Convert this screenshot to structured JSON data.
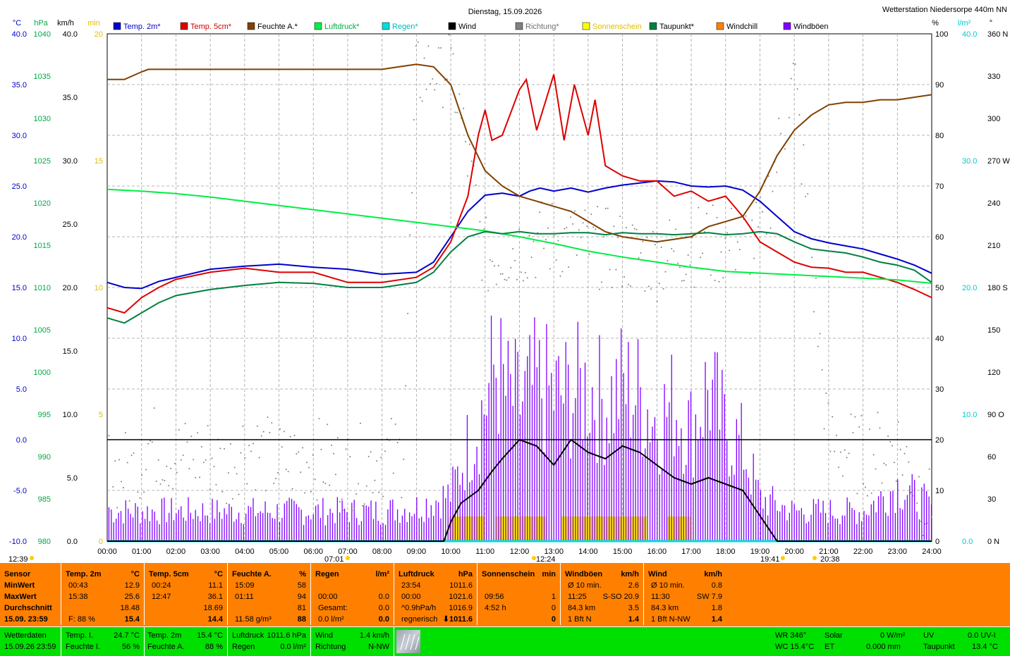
{
  "title": "Dienstag, 15.09.2026",
  "station": "Wetterstation Niedersorpe 440m NN",
  "axis_units": {
    "temp": "°C",
    "hpa": "hPa",
    "kmh": "km/h",
    "min": "min",
    "pct": "%",
    "lm2": "l/m²",
    "deg": "°"
  },
  "axis_ticks": {
    "temp": [
      "40.0",
      "35.0",
      "30.0",
      "25.0",
      "20.0",
      "15.0",
      "10.0",
      "5.0",
      "0.0",
      "-5.0",
      "-10.0"
    ],
    "hpa": [
      "1040",
      "1035",
      "1030",
      "1025",
      "1020",
      "1015",
      "1010",
      "1005",
      "1000",
      "995",
      "990",
      "985",
      "980"
    ],
    "kmh": [
      "40.0",
      "35.0",
      "30.0",
      "25.0",
      "20.0",
      "15.0",
      "10.0",
      "5.0",
      "0.0"
    ],
    "min": [
      "20",
      "15",
      "10",
      "5",
      "0"
    ],
    "pct": [
      "100",
      "90",
      "80",
      "70",
      "60",
      "50",
      "40",
      "30",
      "20",
      "10",
      "0"
    ],
    "lm2": [
      "40.0",
      "30.0",
      "20.0",
      "10.0",
      "0.0"
    ],
    "deg": [
      "360 N",
      "330",
      "300",
      "270 W",
      "240",
      "210",
      "180 S",
      "150",
      "120",
      "90 O",
      "60",
      "30",
      "0 N"
    ],
    "time": [
      "00:00",
      "01:00",
      "02:00",
      "03:00",
      "04:00",
      "05:00",
      "06:00",
      "07:00",
      "08:00",
      "09:00",
      "10:00",
      "11:00",
      "12:00",
      "13:00",
      "14:00",
      "15:00",
      "16:00",
      "17:00",
      "18:00",
      "19:00",
      "20:00",
      "21:00",
      "22:00",
      "23:00",
      "24:00"
    ]
  },
  "sun_marks": {
    "left": "12:39",
    "sunrise": "07:01",
    "noon": "12:24",
    "set1": "19:41",
    "set2": "20:38"
  },
  "chart_data": {
    "type": "line",
    "title": "Dienstag, 15.09.2026",
    "x_unit": "hours",
    "legend": [
      "Temp. 2m*",
      "Temp. 5cm*",
      "Feuchte A.*",
      "Luftdruck*",
      "Regen*",
      "Wind",
      "Richtung*",
      "Sonnenschein",
      "Taupunkt*",
      "Windchill",
      "Windböen"
    ],
    "colors": {
      "Temp. 2m*": "#0000cc",
      "Temp. 5cm*": "#dd0000",
      "Feuchte A.*": "#804000",
      "Luftdruck*": "#00ee44",
      "Regen*": "#00dddd",
      "Wind": "#000000",
      "Richtung*": "#808080",
      "Sonnenschein": "#ffff00",
      "Taupunkt*": "#008040",
      "Windchill": "#ff8000",
      "Windböen": "#8000ff"
    },
    "series": [
      {
        "name": "Temp. 2m*",
        "axis": "temp",
        "x": [
          0,
          0.5,
          1,
          1.5,
          2,
          3,
          4,
          5,
          6,
          7,
          8,
          9,
          9.5,
          10,
          10.5,
          11,
          11.5,
          12,
          12.3,
          12.6,
          13,
          13.5,
          14,
          14.5,
          15,
          15.5,
          16,
          16.5,
          17,
          17.5,
          18,
          18.5,
          19,
          19.5,
          20,
          20.5,
          21,
          21.5,
          22,
          22.5,
          23,
          23.5,
          24
        ],
        "y": [
          15.5,
          15,
          14.9,
          15.6,
          16.0,
          16.8,
          17.1,
          17.3,
          17.0,
          16.8,
          16.3,
          16.5,
          17.5,
          20.0,
          22.5,
          24.1,
          24.3,
          24.0,
          24.5,
          24.8,
          24.5,
          24.8,
          24.4,
          24.8,
          25.1,
          25.3,
          25.5,
          25.4,
          25.0,
          24.9,
          25.0,
          24.6,
          23.5,
          22.0,
          20.5,
          19.8,
          19.4,
          19.1,
          18.8,
          18.3,
          17.8,
          17.2,
          16.4
        ]
      },
      {
        "name": "Temp. 5cm*",
        "axis": "temp",
        "x": [
          0,
          0.5,
          1,
          1.5,
          2,
          3,
          4,
          5,
          6,
          7,
          8,
          9,
          9.5,
          10,
          10.5,
          10.8,
          11,
          11.2,
          11.5,
          12,
          12.2,
          12.5,
          13,
          13.3,
          13.6,
          14,
          14.2,
          14.5,
          15,
          15.5,
          16,
          16.5,
          17,
          17.5,
          18,
          18.5,
          19,
          19.5,
          20,
          20.5,
          21,
          21.5,
          22,
          22.5,
          23,
          23.5,
          24
        ],
        "y": [
          13,
          12.5,
          14,
          15,
          15.8,
          16.5,
          16.9,
          16.5,
          16.5,
          15.5,
          15.5,
          16.0,
          17.0,
          19.5,
          24.0,
          30,
          32.5,
          29.5,
          30,
          34.5,
          35.5,
          30.5,
          36,
          29.5,
          35,
          30,
          33.5,
          27,
          26,
          25.5,
          25.5,
          24,
          24.5,
          23.5,
          24,
          22,
          19.5,
          18.5,
          17.5,
          17,
          16.9,
          16.5,
          16.5,
          16.0,
          15.5,
          14.8,
          14.0
        ]
      },
      {
        "name": "Feuchte A.*",
        "axis": "pct",
        "x": [
          0,
          0.5,
          1,
          1.2,
          1.5,
          2,
          3,
          4,
          5,
          6,
          7,
          8,
          8.5,
          9,
          9.5,
          10,
          10.5,
          11,
          11.5,
          12,
          12.5,
          13,
          13.5,
          14,
          14.5,
          15,
          15.5,
          16,
          16.5,
          17,
          17.5,
          18,
          18.5,
          19,
          19.5,
          20,
          20.5,
          21,
          21.5,
          22,
          22.5,
          23,
          23.5,
          24
        ],
        "y": [
          91,
          91,
          92.5,
          93,
          93,
          93,
          93,
          93,
          93,
          93,
          93,
          93,
          93.5,
          94,
          93.5,
          90,
          80,
          73,
          70,
          68,
          67,
          66,
          65,
          63,
          61,
          60,
          59.5,
          59,
          59.5,
          60,
          62,
          63,
          64,
          69,
          76,
          81,
          84,
          86,
          86.5,
          86.5,
          87,
          87,
          87.5,
          88
        ]
      },
      {
        "name": "Luftdruck*",
        "axis": "hpa",
        "x": [
          0,
          1,
          2,
          3,
          4,
          5,
          6,
          7,
          8,
          9,
          10,
          11,
          12,
          13,
          14,
          15,
          16,
          17,
          18,
          19,
          20,
          21,
          22,
          23,
          24
        ],
        "y": [
          1021.6,
          1021.4,
          1021.1,
          1020.7,
          1020.2,
          1019.7,
          1019.2,
          1018.7,
          1018.2,
          1017.7,
          1017.2,
          1016.7,
          1016.0,
          1015.2,
          1014.3,
          1013.6,
          1013.0,
          1012.4,
          1011.9,
          1011.7,
          1011.5,
          1011.3,
          1011.1,
          1010.9,
          1010.5
        ]
      },
      {
        "name": "Taupunkt*",
        "axis": "temp",
        "x": [
          0,
          0.5,
          1,
          1.5,
          2,
          3,
          4,
          5,
          6,
          7,
          8,
          9,
          9.5,
          10,
          10.5,
          11,
          11.5,
          12,
          12.5,
          13,
          13.5,
          14,
          14.5,
          15,
          15.5,
          16,
          16.5,
          17,
          17.5,
          18,
          18.5,
          19,
          19.5,
          20,
          20.5,
          21,
          21.5,
          22,
          22.5,
          23,
          23.5,
          24
        ],
        "y": [
          12,
          11.5,
          12.5,
          13.5,
          14.2,
          14.8,
          15.2,
          15.5,
          15.4,
          15.0,
          15.0,
          15.5,
          16.5,
          18.5,
          20.0,
          20.5,
          20.3,
          20.5,
          20.3,
          20.3,
          20.4,
          20.4,
          20.2,
          20.4,
          20.3,
          20.3,
          20.2,
          20.3,
          20.4,
          20.2,
          20.3,
          20.5,
          20.3,
          19.5,
          18.8,
          18.6,
          18.4,
          18.0,
          17.5,
          17.2,
          16.7,
          15.5
        ]
      },
      {
        "name": "Regen*",
        "axis": "lm2",
        "x": [
          0,
          24
        ],
        "y": [
          0,
          0
        ]
      },
      {
        "name": "Wind",
        "axis": "kmh",
        "x": [
          0,
          9.8,
          10,
          10.3,
          10.8,
          11.2,
          11.5,
          12,
          12.5,
          13,
          13.5,
          14,
          14.5,
          15,
          15.5,
          16,
          16.5,
          17,
          17.5,
          18,
          18.5,
          19,
          19.5,
          24
        ],
        "y": [
          0,
          0,
          1.5,
          3.0,
          4.0,
          5.5,
          6.5,
          8.0,
          7.5,
          6.0,
          8.0,
          7.0,
          6.5,
          7.5,
          7.0,
          6.0,
          5.0,
          4.5,
          5.0,
          4.5,
          4.0,
          2.0,
          0,
          0
        ]
      },
      {
        "name": "Windböen",
        "axis": "kmh",
        "note": "gust peaks",
        "x": [
          0.1,
          0.8,
          1.2,
          2,
          3,
          4,
          5,
          6,
          7,
          8,
          9,
          10,
          10.5,
          11,
          11.3,
          11.6,
          12,
          12.5,
          13,
          13.5,
          14,
          14.5,
          15,
          15.5,
          16,
          16.5,
          17,
          17.5,
          18,
          18.5,
          19,
          20,
          21,
          22,
          23,
          24
        ],
        "y": [
          3.5,
          3.5,
          3.5,
          3.5,
          3.5,
          3.5,
          3.5,
          3.5,
          3.5,
          3.5,
          4.0,
          5.5,
          11.0,
          16.0,
          20.9,
          17.0,
          16.0,
          18.0,
          17.0,
          17.0,
          18.0,
          16.0,
          18.0,
          17.0,
          14.0,
          16.0,
          13.0,
          18.0,
          13.0,
          11.0,
          5.0,
          3.5,
          3.5,
          3.5,
          6.5,
          4.0
        ]
      },
      {
        "name": "Sonnenschein",
        "axis": "min",
        "x": [
          9.95,
          10.5,
          11,
          11.3,
          12,
          12.8,
          13.2,
          13.8,
          14.5,
          15,
          15.7,
          16.3,
          17
        ],
        "y": [
          1,
          1,
          0,
          1,
          1,
          0,
          1,
          1,
          1,
          1,
          0,
          1,
          1
        ]
      },
      {
        "name": "Richtung*",
        "axis": "deg",
        "x": [
          0,
          0.9,
          1.2,
          2,
          2.5,
          3,
          3.5,
          4,
          5,
          6,
          7,
          8,
          8.6,
          9,
          10,
          11,
          12,
          13,
          14,
          15,
          16,
          17,
          18,
          19,
          20,
          21,
          22,
          23,
          24
        ],
        "y": [
          50,
          50,
          70,
          60,
          60,
          60,
          50,
          70,
          55,
          60,
          50,
          60,
          60,
          330,
          340,
          200,
          210,
          215,
          210,
          205,
          200,
          210,
          210,
          215,
          330,
          70,
          60,
          70,
          20
        ]
      }
    ],
    "ylim": {
      "temp": [
        -10,
        40
      ],
      "hpa": [
        980,
        1040
      ],
      "kmh": [
        0,
        40
      ],
      "min": [
        0,
        20
      ],
      "pct": [
        0,
        100
      ],
      "lm2": [
        0,
        40
      ],
      "deg": [
        0,
        360
      ]
    },
    "xlim": [
      0,
      24
    ],
    "grid": true
  },
  "stats": {
    "sensor": {
      "title": "Sensor",
      "rows": [
        "MinWert",
        "MaxWert",
        "Durchschnitt",
        "15.09. 23:59"
      ]
    },
    "temp2m": {
      "title": "Temp. 2m",
      "unit": "°C",
      "rows": [
        [
          "00:43",
          "12.9"
        ],
        [
          "15:38",
          "25.6"
        ],
        [
          "",
          "18.48"
        ],
        [
          "F: 88 %",
          "15.4"
        ]
      ]
    },
    "temp5cm": {
      "title": "Temp. 5cm",
      "unit": "°C",
      "rows": [
        [
          "00:24",
          "11.1"
        ],
        [
          "12:47",
          "36.1"
        ],
        [
          "",
          "18.69"
        ],
        [
          "",
          "14.4"
        ]
      ]
    },
    "feuchte": {
      "title": "Feuchte A.",
      "unit": "%",
      "rows": [
        [
          "15:09",
          "58"
        ],
        [
          "01:11",
          "94"
        ],
        [
          "",
          "81"
        ],
        [
          "11.58 g/m³",
          "88"
        ]
      ]
    },
    "regen": {
      "title": "Regen",
      "unit": "l/m²",
      "rows": [
        [
          "",
          ""
        ],
        [
          "00:00",
          "0.0"
        ],
        [
          "Gesamt:",
          "0.0"
        ],
        [
          "0.0 l/m²",
          "0.0"
        ]
      ]
    },
    "luftdruck": {
      "title": "Luftdruck",
      "unit": "hPa",
      "rows": [
        [
          "23:54",
          "1011.6"
        ],
        [
          "00:00",
          "1021.6"
        ],
        [
          "^0.9hPa/h",
          "1016.9"
        ],
        [
          "regnerisch",
          "⬇1011.6"
        ]
      ]
    },
    "sonne": {
      "title": "Sonnenschein",
      "unit": "min",
      "rows": [
        [
          "",
          ""
        ],
        [
          "09:56",
          "1"
        ],
        [
          "4:52 h",
          "0"
        ],
        [
          "",
          "0"
        ]
      ]
    },
    "windboeen": {
      "title": "Windböen",
      "unit": "km/h",
      "rows": [
        [
          "Ø 10 min.",
          "2.6"
        ],
        [
          "11:25",
          "S-SO 20.9"
        ],
        [
          "84.3 km",
          "3.5"
        ],
        [
          "1 Bft N",
          "1.4"
        ]
      ]
    },
    "wind": {
      "title": "Wind",
      "unit": "km/h",
      "rows": [
        [
          "Ø 10 min.",
          "0.8"
        ],
        [
          "11:30",
          "SW 7.9"
        ],
        [
          "84.3 km",
          "1.8"
        ],
        [
          "1 Bft N-NW",
          "1.4"
        ]
      ]
    }
  },
  "footer": {
    "station_label": "Wetterdaten",
    "station_time": "15.09.26 23:59",
    "tempi_label": "Temp. I.",
    "tempi": "24.7 °C",
    "feuchtei_label": "Feuchte I.",
    "feuchtei": "56 %",
    "temp2m_label": "Temp. 2m",
    "temp2m": "15.4 °C",
    "feuchtea_label": "Feuchte A.",
    "feuchtea": "88 %",
    "luftdruck_label": "Luftdruck",
    "luftdruck": "1011.6 hPa",
    "regen_label": "Regen",
    "regen": "0.0 l/m²",
    "wind_label": "Wind",
    "wind": "1.4 km/h",
    "richtung_label": "Richtung",
    "richtung": "N-NW",
    "wr": "WR 346°",
    "wc": "WC 15.4°C",
    "solar_label": "Solar",
    "solar": "0 W/m²",
    "et_label": "ET",
    "et": "0.000 mm",
    "uv_label": "UV",
    "uv": "0.0 UV-I",
    "taupunkt_label": "Taupunkt",
    "taupunkt": "13.4 °C"
  }
}
